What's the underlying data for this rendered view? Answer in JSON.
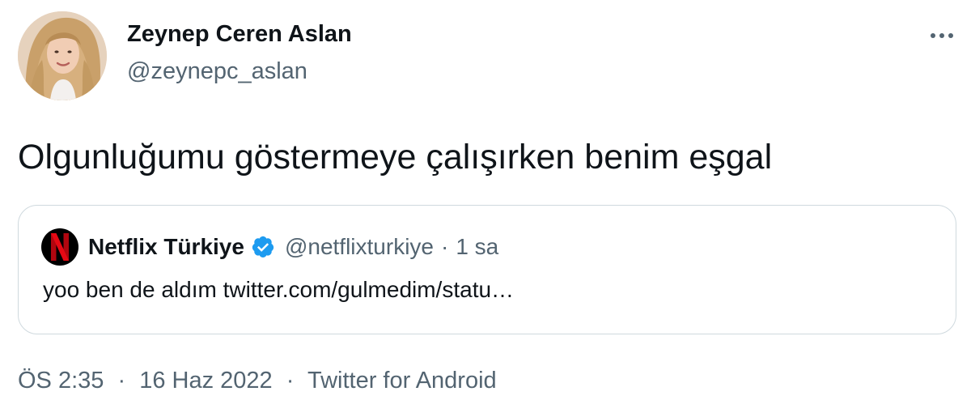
{
  "author": {
    "name": "Zeynep Ceren Aslan",
    "handle": "@zeynepc_aslan"
  },
  "tweet": {
    "text": "Olgunluğumu göstermeye çalışırken benim eşgal"
  },
  "quoted_tweet": {
    "name": "Netflix Türkiye",
    "verified": true,
    "handle": "@netflixturkiye",
    "separator": "·",
    "time": "1 sa",
    "text": "yoo ben de aldım twitter.com/gulmedim/statu…"
  },
  "meta": {
    "time": "ÖS 2:35",
    "separator1": "·",
    "date": "16 Haz 2022",
    "separator2": "·",
    "source": "Twitter for Android"
  },
  "icons": {
    "more": "more-horizontal-icon",
    "verified": "verified-badge-icon",
    "netflix": "netflix-logo"
  },
  "colors": {
    "text_primary": "#0f1419",
    "text_secondary": "#536471",
    "border": "#cfd9de",
    "verified_blue": "#1d9bf0",
    "netflix_red": "#e50914"
  }
}
